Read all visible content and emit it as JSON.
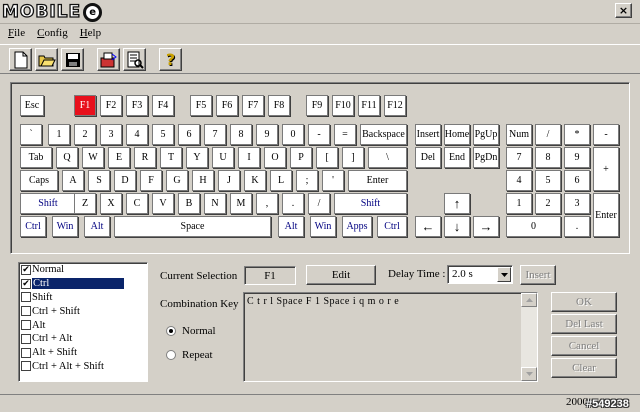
{
  "app": {
    "logo_text": "MOBILE",
    "logo_mark": "e",
    "close_glyph": "×"
  },
  "menu": {
    "file": "File",
    "config": "Config",
    "help": "Help"
  },
  "toolbar": {
    "help_glyph": "?"
  },
  "keyboard": {
    "row_fn": [
      "Esc",
      "F1",
      "F2",
      "F3",
      "F4",
      "F5",
      "F6",
      "F7",
      "F8",
      "F9",
      "F10",
      "F11",
      "F12"
    ],
    "row_num": [
      "`",
      "1",
      "2",
      "3",
      "4",
      "5",
      "6",
      "7",
      "8",
      "9",
      "0",
      "-",
      "=",
      "Backspace"
    ],
    "row_q": [
      "Tab",
      "Q",
      "W",
      "E",
      "R",
      "T",
      "Y",
      "U",
      "I",
      "O",
      "P",
      "[",
      "]",
      "\\"
    ],
    "row_a": [
      "Caps",
      "A",
      "S",
      "D",
      "F",
      "G",
      "H",
      "J",
      "K",
      "L",
      ";",
      "'",
      "Enter"
    ],
    "row_z": [
      "Shift",
      "Z",
      "X",
      "C",
      "V",
      "B",
      "N",
      "M",
      ",",
      ".",
      "/",
      "Shift"
    ],
    "row_space": [
      "Ctrl",
      "Win",
      "Alt",
      "Space",
      "Alt",
      "Win",
      "Apps",
      "Ctrl"
    ],
    "nav_top": [
      "Insert",
      "Home",
      "PgUp"
    ],
    "nav_mid": [
      "Del",
      "End",
      "PgDn"
    ],
    "arrows": {
      "up": "↑",
      "left": "←",
      "down": "↓",
      "right": "→"
    },
    "numpad": {
      "row1": [
        "Num",
        "/",
        "*",
        "-"
      ],
      "row2": [
        "7",
        "8",
        "9"
      ],
      "row3": [
        "4",
        "5",
        "6"
      ],
      "row4": [
        "1",
        "2",
        "3"
      ],
      "row5": [
        "0",
        "."
      ],
      "plus": "+",
      "enter": "Enter"
    },
    "active_key": "F1"
  },
  "modifiers": [
    {
      "label": "Normal",
      "checked": true
    },
    {
      "label": "Ctrl",
      "checked": true
    },
    {
      "label": "Shift",
      "checked": false
    },
    {
      "label": "Ctrl + Shift",
      "checked": false
    },
    {
      "label": "Alt",
      "checked": false
    },
    {
      "label": "Ctrl + Alt",
      "checked": false
    },
    {
      "label": "Alt + Shift",
      "checked": false
    },
    {
      "label": "Ctrl + Alt + Shift",
      "checked": false
    }
  ],
  "modifiers_selected_index": 1,
  "selection": {
    "label": "Current Selection",
    "value": "F1",
    "edit_label": "Edit"
  },
  "delay": {
    "label": "Delay Time :",
    "value": "2.0 s",
    "insert_label": "Insert"
  },
  "combination": {
    "label": "Combination Key",
    "normal": "Normal",
    "repeat": "Repeat",
    "selected": "normal",
    "text": "C t r l Space F 1 Space i q m o r e"
  },
  "actions": {
    "ok": "OK",
    "del_last": "Del Last",
    "cancel": "Cancel",
    "clear": "Clear"
  },
  "status": {
    "text": "2000"
  },
  "watermark": "#549238"
}
